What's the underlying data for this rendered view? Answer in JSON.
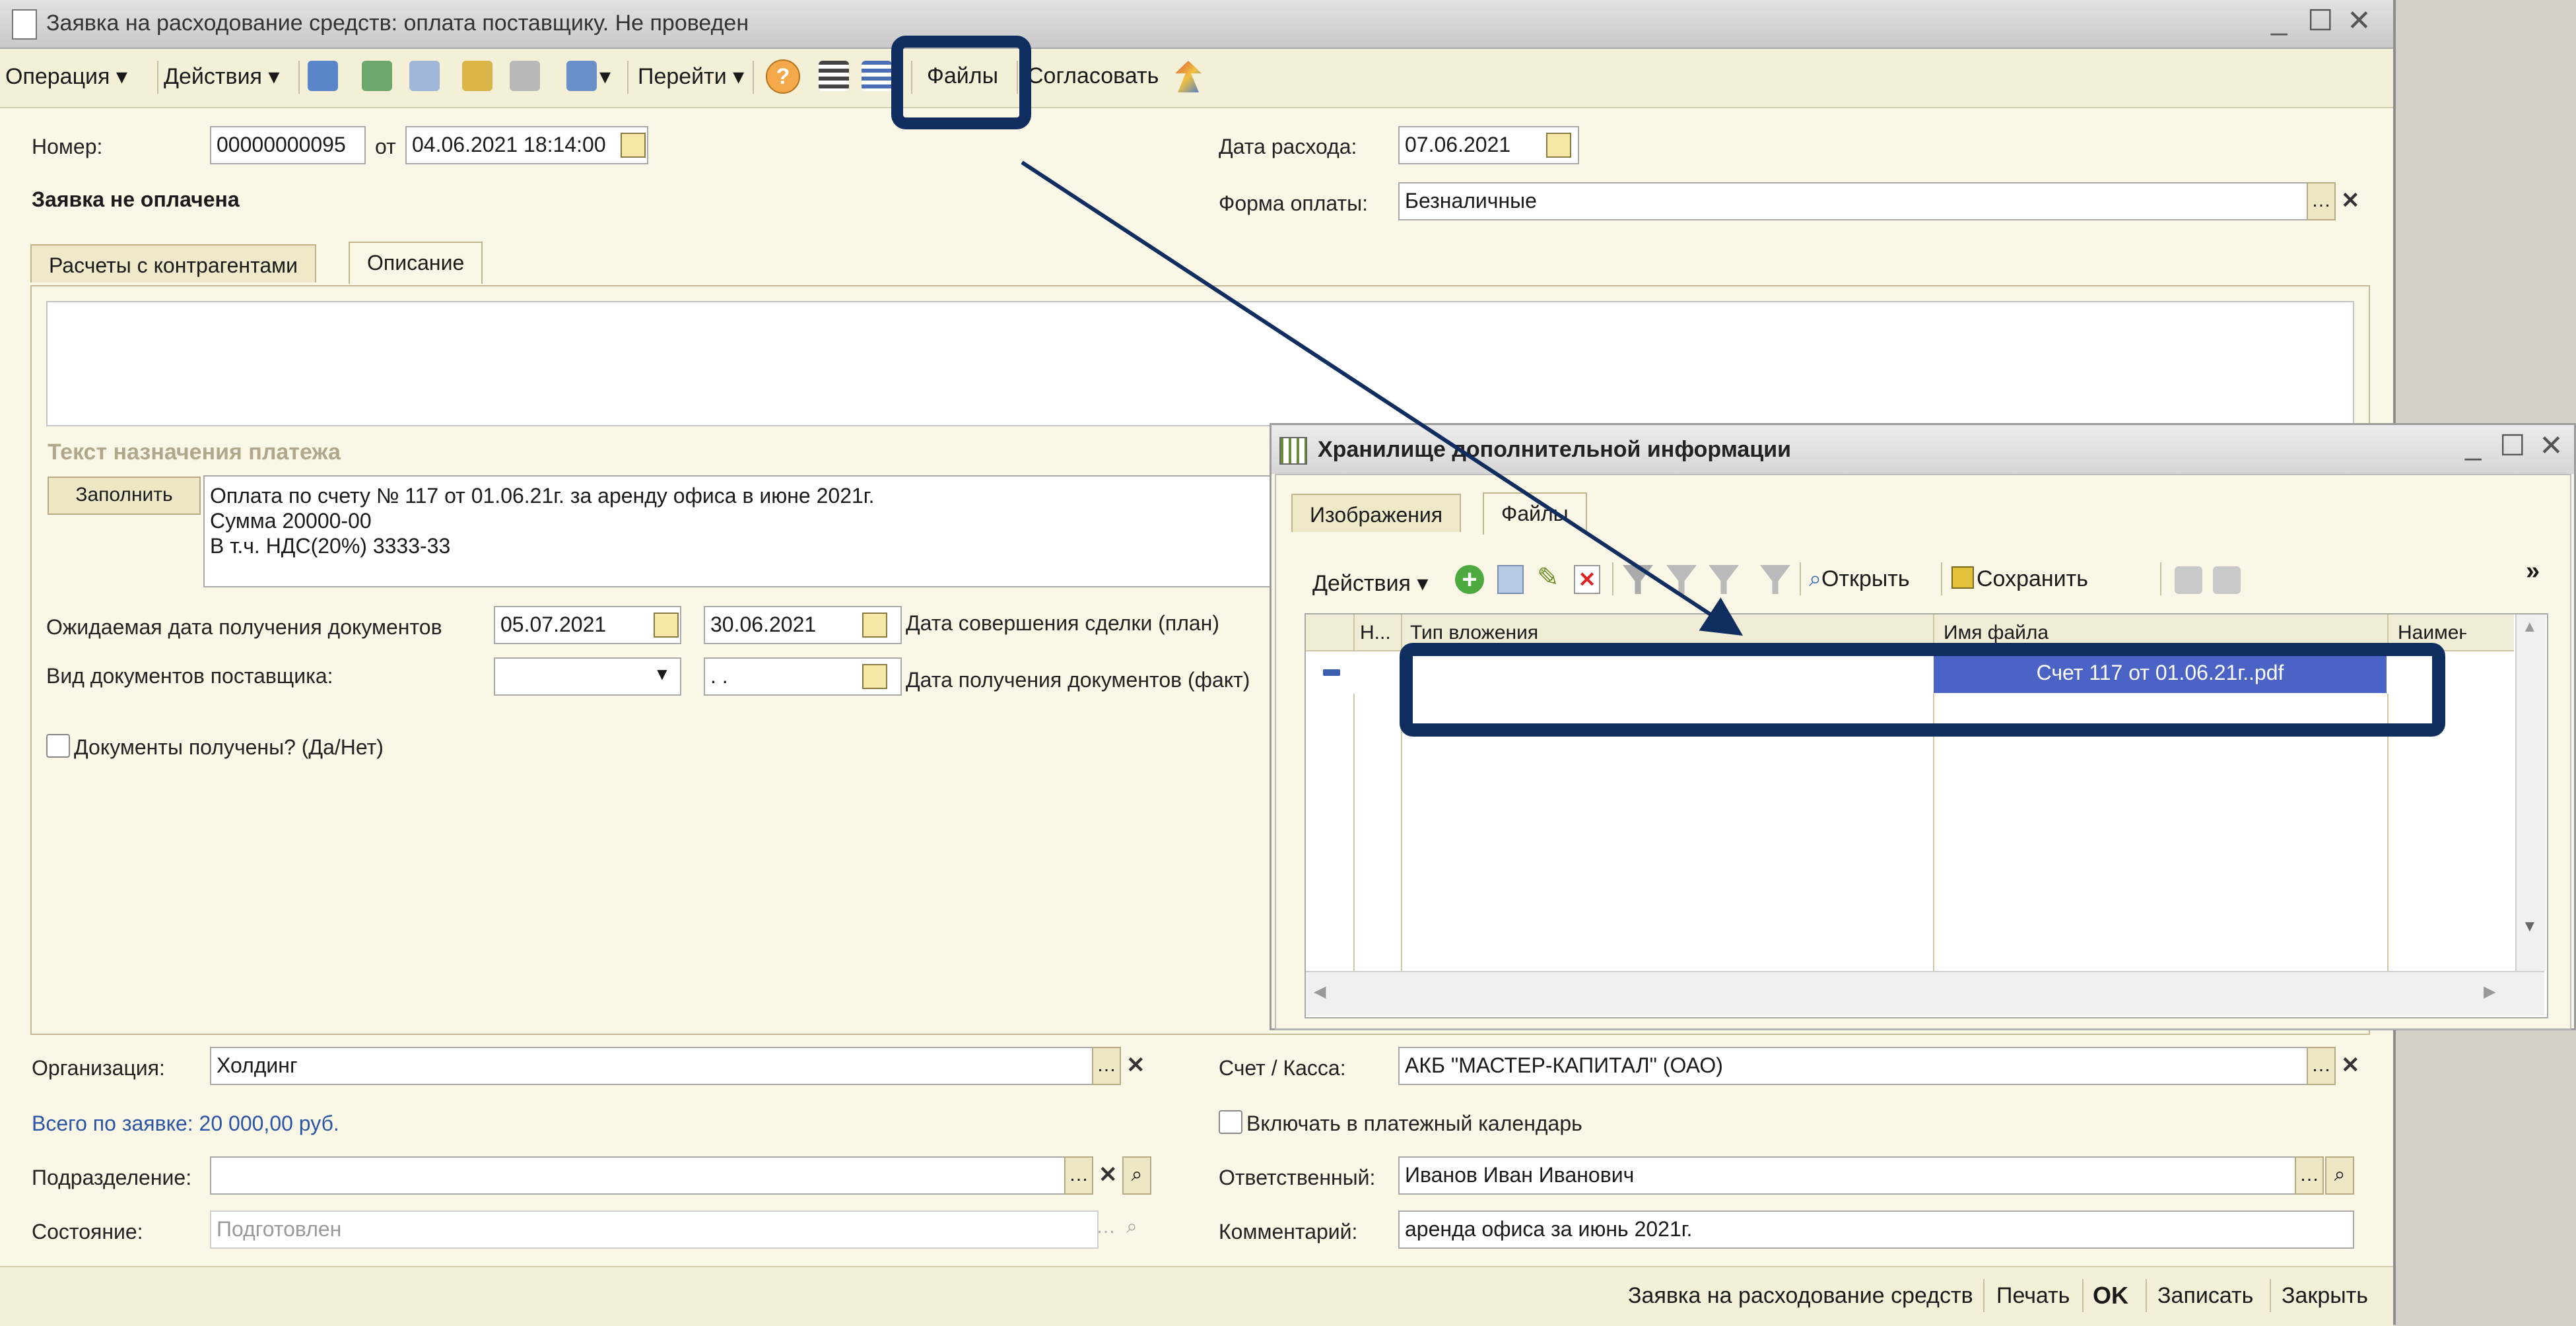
{
  "window": {
    "title": "Заявка на расходование средств: оплата поставщику. Не проведен",
    "controls": [
      "_",
      "☐",
      "✕"
    ]
  },
  "toolbar": {
    "operation": "Операция",
    "actions": "Действия",
    "goto": "Перейти",
    "files": "Файлы",
    "approve": "Согласовать"
  },
  "header": {
    "number_label": "Номер:",
    "number_value": "00000000095",
    "from_label": "от",
    "date_value": "04.06.2021 18:14:00",
    "status": "Заявка не оплачена",
    "expense_date_label": "Дата расхода:",
    "expense_date_value": "07.06.2021",
    "payment_form_label": "Форма оплаты:",
    "payment_form_value": "Безналичные"
  },
  "tabs": [
    "Расчеты с контрагентами",
    "Описание"
  ],
  "description": {
    "purpose_heading": "Текст назначения платежа",
    "fill_button": "Заполнить",
    "purpose_lines": [
      "Оплата по счету № 117 от 01.06.21г. за аренду офиса в июне 2021г.",
      "Сумма 20000-00",
      "В т.ч. НДС(20%) 3333-33"
    ],
    "expected_docs_label": "Ожидаемая дата получения документов",
    "expected_docs_value": "05.07.2021",
    "deal_date_value": "30.06.2021",
    "deal_date_label": "Дата совершения сделки (план)",
    "supplier_docs_label": "Вид документов поставщика:",
    "docs_fact_value": " .  .",
    "docs_fact_label": "Дата получения документов (факт)",
    "docs_received_label": "Документы получены? (Да/Нет)"
  },
  "bottom": {
    "org_label": "Организация:",
    "org_value": "Холдинг",
    "account_label": "Счет / Касса:",
    "account_value": "АКБ \"МАСТЕР-КАПИТАЛ\" (ОАО)",
    "total_text": "Всего по заявке: 20 000,00 руб.",
    "include_calendar_label": "Включать в платежный календарь",
    "dept_label": "Подразделение:",
    "dept_value": "",
    "responsible_label": "Ответственный:",
    "responsible_value": "Иванов Иван Иванович",
    "state_label": "Состояние:",
    "state_value": "Подготовлен",
    "comment_label": "Комментарий:",
    "comment_value": "аренда офиса за июнь 2021г."
  },
  "footer": {
    "doc_link": "Заявка на расходование средств",
    "print": "Печать",
    "ok": "OK",
    "save": "Записать",
    "close": "Закрыть"
  },
  "popup": {
    "title": "Хранилище дополнительной информации",
    "tabs": [
      "Изображения",
      "Файлы"
    ],
    "actions": "Действия",
    "open": "Открыть",
    "save": "Сохранить",
    "more": "»",
    "columns": [
      "Н...",
      "Тип вложения",
      "Имя файла",
      "Наименова"
    ],
    "rows": [
      {
        "type": "",
        "filename": "Счет 117 от 01.06.21г..pdf",
        "name": ""
      }
    ]
  },
  "colors": {
    "highlight": "#0f2d5e",
    "selected_row": "#4a63c4",
    "link_blue": "#2a55a6"
  }
}
